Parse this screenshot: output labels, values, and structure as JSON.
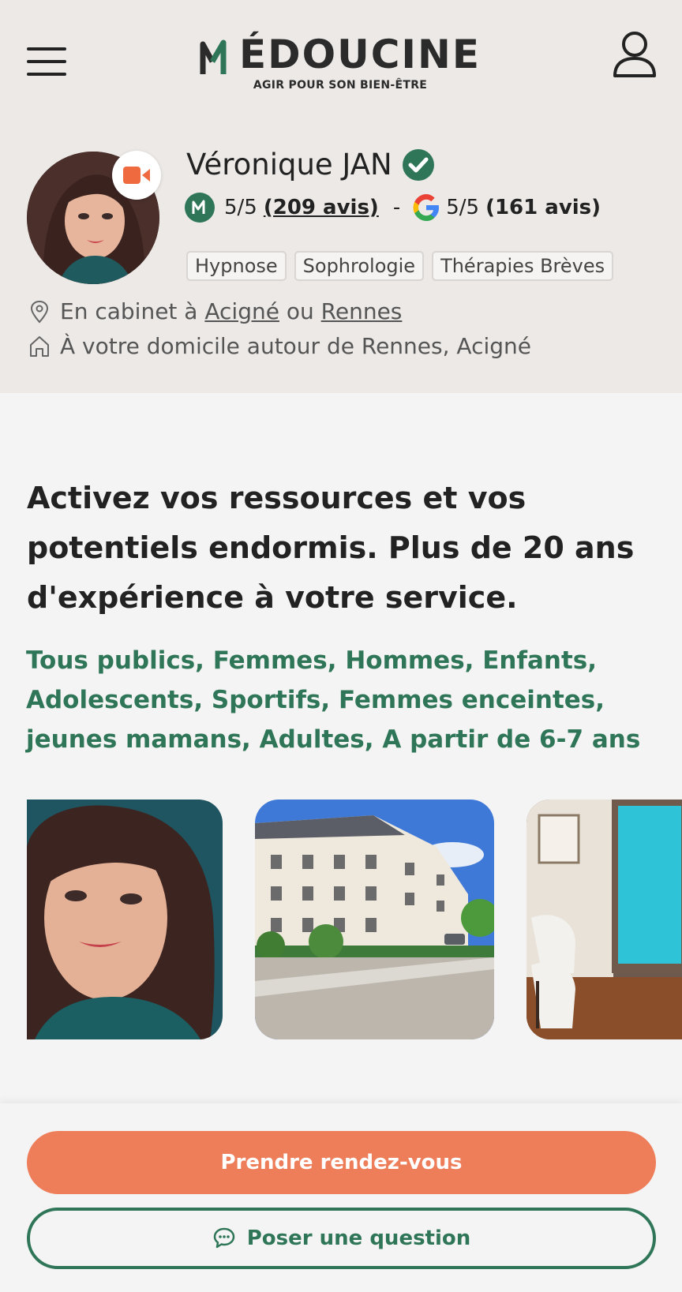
{
  "header": {
    "logo_title": "ÉDOUCINE",
    "logo_subtitle": "AGIR POUR SON BIEN-ÊTRE",
    "menu_icon": "hamburger-menu-icon",
    "account_icon": "user-icon"
  },
  "profile": {
    "name": "Véronique JAN",
    "verified_icon": "check-badge-icon",
    "video_icon": "video-camera-icon",
    "ratings": {
      "medoucine_score": "5/5",
      "medoucine_reviews": "(209 avis)",
      "separator": "-",
      "google_score": "5/5",
      "google_reviews": "(161 avis)"
    },
    "tags": [
      "Hypnose",
      "Sophrologie",
      "Thérapies Brèves"
    ],
    "location": {
      "cabinet_prefix": "En cabinet à",
      "city1": "Acigné",
      "conjunction": "ou",
      "city2": "Rennes",
      "home_text": "À votre domicile autour de Rennes, Acigné"
    }
  },
  "main": {
    "headline": "Activez vos ressources et vos potentiels endormis. Plus de 20 ans d'expérience à votre service.",
    "publics": "Tous publics, Femmes, Hommes, Enfants, Adolescents, Sportifs, Femmes enceintes, jeunes mamans, Adultes, A partir de 6-7 ans"
  },
  "actions": {
    "book_label": "Prendre rendez-vous",
    "question_label": "Poser une question",
    "question_icon": "chat-bubble-icon"
  },
  "colors": {
    "brand_green": "#2f7658",
    "accent_orange": "#ee7d5a",
    "header_bg": "#ece9e6"
  }
}
